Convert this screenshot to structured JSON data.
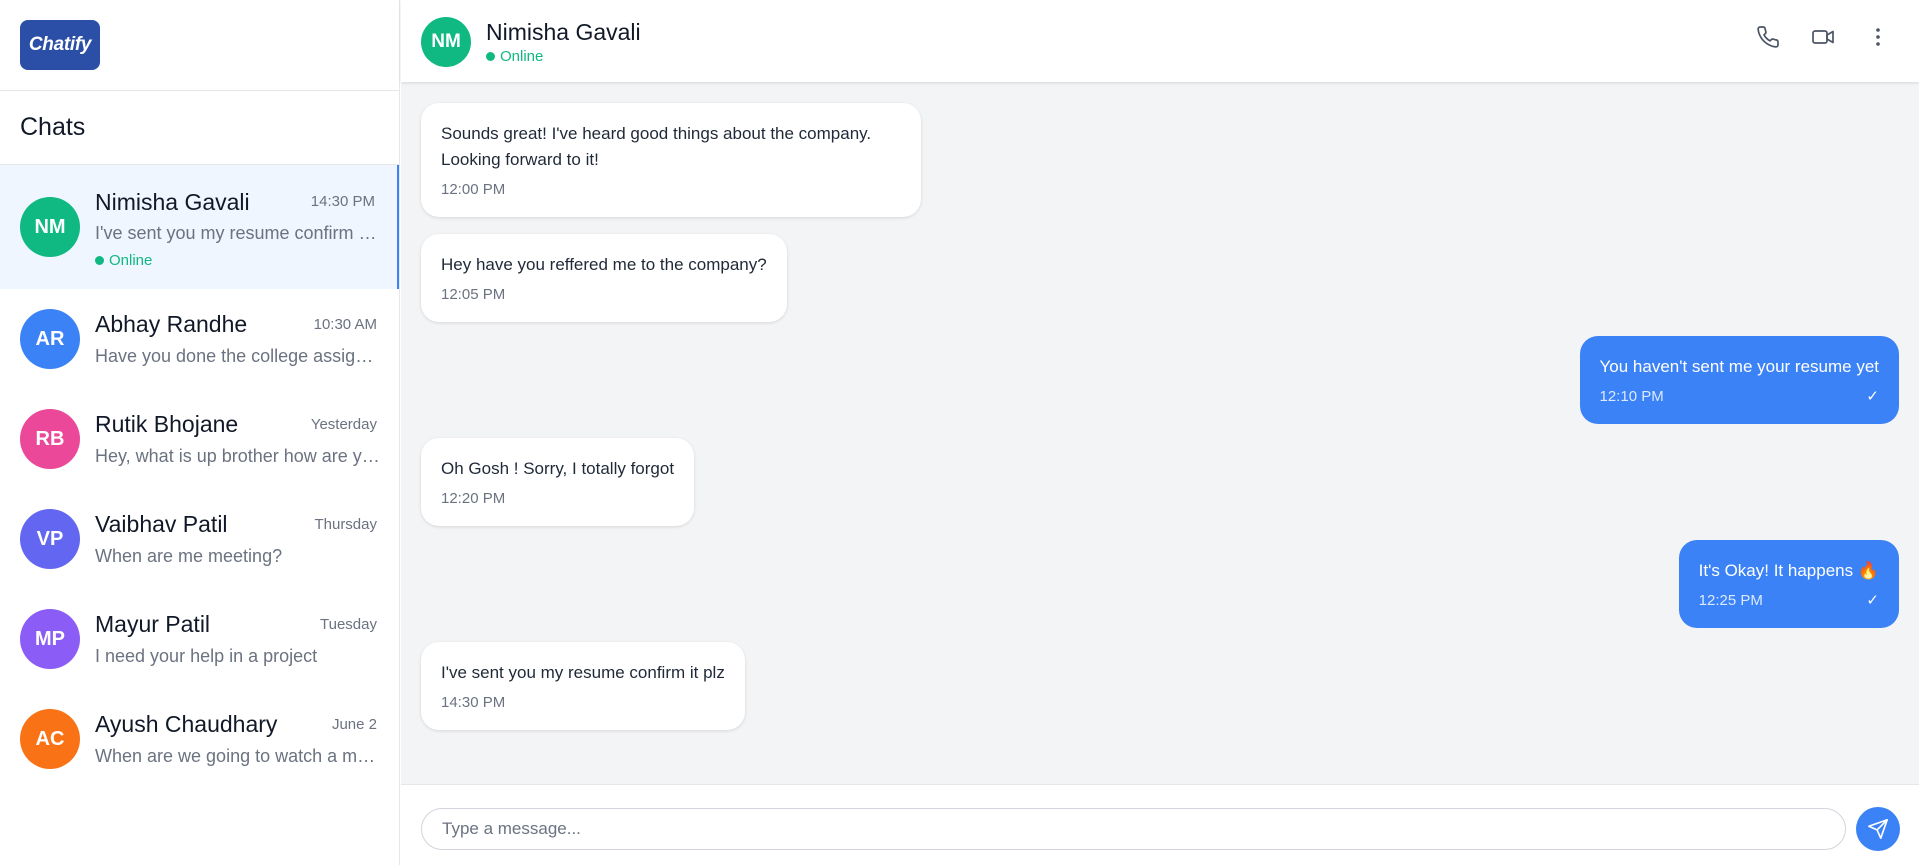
{
  "app": {
    "logo_text": "Chatify",
    "brand_color": "#2b4fa6",
    "accent_color": "#3b82f6",
    "online_color": "#10b981"
  },
  "sidebar": {
    "title": "Chats",
    "items": [
      {
        "initials": "NM",
        "name": "Nimisha Gavali",
        "time": "14:30 PM",
        "preview": "I've sent you my resume confirm it plz",
        "status": "Online",
        "avatar_color": "#10b981",
        "active": true
      },
      {
        "initials": "AR",
        "name": "Abhay Randhe",
        "time": "10:30 AM",
        "preview": "Have you done the college assignment?",
        "avatar_color": "#3b82f6"
      },
      {
        "initials": "RB",
        "name": "Rutik Bhojane",
        "time": "Yesterday",
        "preview": "Hey, what is up brother how are you doing?",
        "avatar_color": "#ec4899"
      },
      {
        "initials": "VP",
        "name": "Vaibhav Patil",
        "time": "Thursday",
        "preview": "When are me meeting?",
        "avatar_color": "#6366f1"
      },
      {
        "initials": "MP",
        "name": "Mayur Patil",
        "time": "Tuesday",
        "preview": "I need your help in a project",
        "avatar_color": "#8b5cf6"
      },
      {
        "initials": "AC",
        "name": "Ayush Chaudhary",
        "time": "June 2",
        "preview": "When are we going to watch a movie?",
        "avatar_color": "#f97316"
      }
    ]
  },
  "header": {
    "initials": "NM",
    "name": "Nimisha Gavali",
    "status": "Online",
    "icons": [
      "phone-icon",
      "video-icon",
      "more-vertical-icon"
    ]
  },
  "messages": [
    {
      "direction": "in",
      "lines": [
        "Sounds great! I've heard good things about the company.",
        "Looking forward to it!"
      ],
      "time": "12:00 PM"
    },
    {
      "direction": "in",
      "lines": [
        "Hey have you reffered me to the company?"
      ],
      "time": "12:05 PM"
    },
    {
      "direction": "out",
      "lines": [
        "You haven't sent me your resume yet"
      ],
      "time": "12:10 PM",
      "check": "✓"
    },
    {
      "direction": "in",
      "lines": [
        "Oh Gosh ! Sorry, I totally forgot"
      ],
      "time": "12:20 PM"
    },
    {
      "direction": "out",
      "lines": [
        "It's Okay! It happens 🔥"
      ],
      "time": "12:25 PM",
      "check": "✓"
    },
    {
      "direction": "in",
      "lines": [
        "I've sent you my resume confirm it plz"
      ],
      "time": "14:30 PM"
    }
  ],
  "composer": {
    "placeholder": "Type a message...",
    "value": ""
  }
}
